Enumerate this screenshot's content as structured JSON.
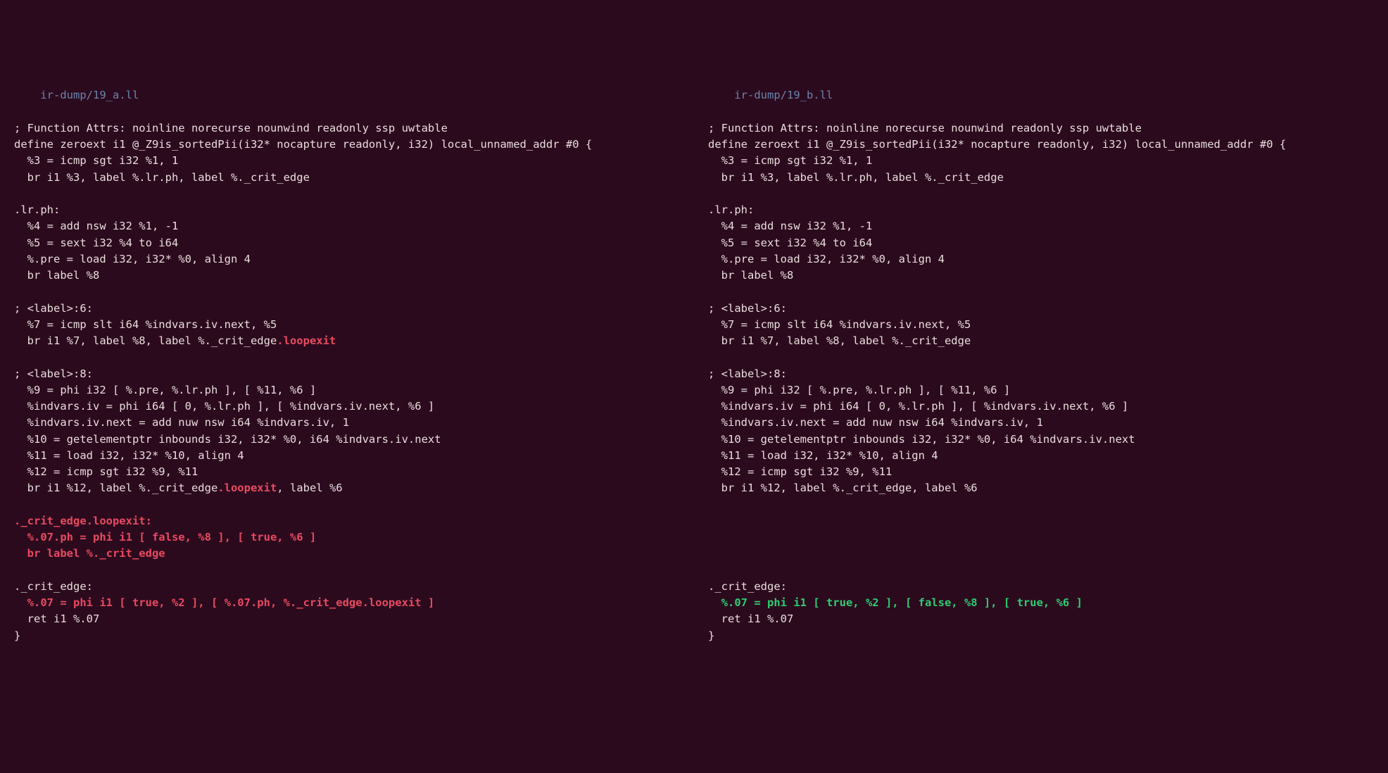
{
  "left": {
    "filename": "ir-dump/19_a.ll",
    "lines": [
      {
        "segs": [
          {
            "t": "; Function Attrs: noinline norecurse nounwind readonly ssp uwtable"
          }
        ]
      },
      {
        "segs": [
          {
            "t": "define zeroext i1 @_Z9is_sortedPii(i32* nocapture readonly, i32) local_unnamed_addr #0 {"
          }
        ]
      },
      {
        "segs": [
          {
            "t": "  %3 = icmp sgt i32 %1, 1"
          }
        ]
      },
      {
        "segs": [
          {
            "t": "  br i1 %3, label %.lr.ph, label %._crit_edge"
          }
        ]
      },
      {
        "segs": [
          {
            "t": ""
          }
        ]
      },
      {
        "segs": [
          {
            "t": ".lr.ph:"
          }
        ]
      },
      {
        "segs": [
          {
            "t": "  %4 = add nsw i32 %1, -1"
          }
        ]
      },
      {
        "segs": [
          {
            "t": "  %5 = sext i32 %4 to i64"
          }
        ]
      },
      {
        "segs": [
          {
            "t": "  %.pre = load i32, i32* %0, align 4"
          }
        ]
      },
      {
        "segs": [
          {
            "t": "  br label %8"
          }
        ]
      },
      {
        "segs": [
          {
            "t": ""
          }
        ]
      },
      {
        "segs": [
          {
            "t": "; <label>:6:"
          }
        ]
      },
      {
        "segs": [
          {
            "t": "  %7 = icmp slt i64 %indvars.iv.next, %5"
          }
        ]
      },
      {
        "segs": [
          {
            "t": "  br i1 %7, label %8, label %._crit_edge"
          },
          {
            "t": ".loopexit",
            "cls": "red bold"
          }
        ]
      },
      {
        "segs": [
          {
            "t": ""
          }
        ]
      },
      {
        "segs": [
          {
            "t": "; <label>:8:"
          }
        ]
      },
      {
        "segs": [
          {
            "t": "  %9 = phi i32 [ %.pre, %.lr.ph ], [ %11, %6 ]"
          }
        ]
      },
      {
        "segs": [
          {
            "t": "  %indvars.iv = phi i64 [ 0, %.lr.ph ], [ %indvars.iv.next, %6 ]"
          }
        ]
      },
      {
        "segs": [
          {
            "t": "  %indvars.iv.next = add nuw nsw i64 %indvars.iv, 1"
          }
        ]
      },
      {
        "segs": [
          {
            "t": "  %10 = getelementptr inbounds i32, i32* %0, i64 %indvars.iv.next"
          }
        ]
      },
      {
        "segs": [
          {
            "t": "  %11 = load i32, i32* %10, align 4"
          }
        ]
      },
      {
        "segs": [
          {
            "t": "  %12 = icmp sgt i32 %9, %11"
          }
        ]
      },
      {
        "segs": [
          {
            "t": "  br i1 %12, label %._crit_edge"
          },
          {
            "t": ".loopexit",
            "cls": "red bold"
          },
          {
            "t": ", label %6"
          }
        ]
      },
      {
        "segs": [
          {
            "t": ""
          }
        ]
      },
      {
        "segs": [
          {
            "t": "._crit_edge.loopexit:",
            "cls": "red bold"
          }
        ]
      },
      {
        "segs": [
          {
            "t": "  %.07.ph = phi i1 [ false, %8 ], [ true, %6 ]",
            "cls": "red bold"
          }
        ]
      },
      {
        "segs": [
          {
            "t": "  br label %._crit_edge",
            "cls": "red bold"
          }
        ]
      },
      {
        "segs": [
          {
            "t": ""
          }
        ]
      },
      {
        "segs": [
          {
            "t": "._crit_edge:"
          }
        ]
      },
      {
        "segs": [
          {
            "t": "  %.07 = phi i1 [ true, %2 ], [ %.07.ph, %._crit_edge.loopexit ]",
            "cls": "red bold"
          }
        ]
      },
      {
        "segs": [
          {
            "t": "  ret i1 %.07"
          }
        ]
      },
      {
        "segs": [
          {
            "t": "}"
          }
        ]
      }
    ]
  },
  "right": {
    "filename": "ir-dump/19_b.ll",
    "lines": [
      {
        "segs": [
          {
            "t": "; Function Attrs: noinline norecurse nounwind readonly ssp uwtable"
          }
        ]
      },
      {
        "segs": [
          {
            "t": "define zeroext i1 @_Z9is_sortedPii(i32* nocapture readonly, i32) local_unnamed_addr #0 {"
          }
        ]
      },
      {
        "segs": [
          {
            "t": "  %3 = icmp sgt i32 %1, 1"
          }
        ]
      },
      {
        "segs": [
          {
            "t": "  br i1 %3, label %.lr.ph, label %._crit_edge"
          }
        ]
      },
      {
        "segs": [
          {
            "t": ""
          }
        ]
      },
      {
        "segs": [
          {
            "t": ".lr.ph:"
          }
        ]
      },
      {
        "segs": [
          {
            "t": "  %4 = add nsw i32 %1, -1"
          }
        ]
      },
      {
        "segs": [
          {
            "t": "  %5 = sext i32 %4 to i64"
          }
        ]
      },
      {
        "segs": [
          {
            "t": "  %.pre = load i32, i32* %0, align 4"
          }
        ]
      },
      {
        "segs": [
          {
            "t": "  br label %8"
          }
        ]
      },
      {
        "segs": [
          {
            "t": ""
          }
        ]
      },
      {
        "segs": [
          {
            "t": "; <label>:6:"
          }
        ]
      },
      {
        "segs": [
          {
            "t": "  %7 = icmp slt i64 %indvars.iv.next, %5"
          }
        ]
      },
      {
        "segs": [
          {
            "t": "  br i1 %7, label %8, label %._crit_edge"
          }
        ]
      },
      {
        "segs": [
          {
            "t": ""
          }
        ]
      },
      {
        "segs": [
          {
            "t": "; <label>:8:"
          }
        ]
      },
      {
        "segs": [
          {
            "t": "  %9 = phi i32 [ %.pre, %.lr.ph ], [ %11, %6 ]"
          }
        ]
      },
      {
        "segs": [
          {
            "t": "  %indvars.iv = phi i64 [ 0, %.lr.ph ], [ %indvars.iv.next, %6 ]"
          }
        ]
      },
      {
        "segs": [
          {
            "t": "  %indvars.iv.next = add nuw nsw i64 %indvars.iv, 1"
          }
        ]
      },
      {
        "segs": [
          {
            "t": "  %10 = getelementptr inbounds i32, i32* %0, i64 %indvars.iv.next"
          }
        ]
      },
      {
        "segs": [
          {
            "t": "  %11 = load i32, i32* %10, align 4"
          }
        ]
      },
      {
        "segs": [
          {
            "t": "  %12 = icmp sgt i32 %9, %11"
          }
        ]
      },
      {
        "segs": [
          {
            "t": "  br i1 %12, label %._crit_edge, label %6"
          }
        ]
      },
      {
        "segs": [
          {
            "t": ""
          }
        ]
      },
      {
        "segs": [
          {
            "t": ""
          }
        ]
      },
      {
        "segs": [
          {
            "t": ""
          }
        ]
      },
      {
        "segs": [
          {
            "t": ""
          }
        ]
      },
      {
        "segs": [
          {
            "t": ""
          }
        ]
      },
      {
        "segs": [
          {
            "t": "._crit_edge:"
          }
        ]
      },
      {
        "segs": [
          {
            "t": "  %.07 = phi i1 [ true, %2 ], [ false, %8 ], [ true, %6 ]",
            "cls": "green bold"
          }
        ]
      },
      {
        "segs": [
          {
            "t": "  ret i1 %.07"
          }
        ]
      },
      {
        "segs": [
          {
            "t": "}"
          }
        ]
      }
    ]
  }
}
